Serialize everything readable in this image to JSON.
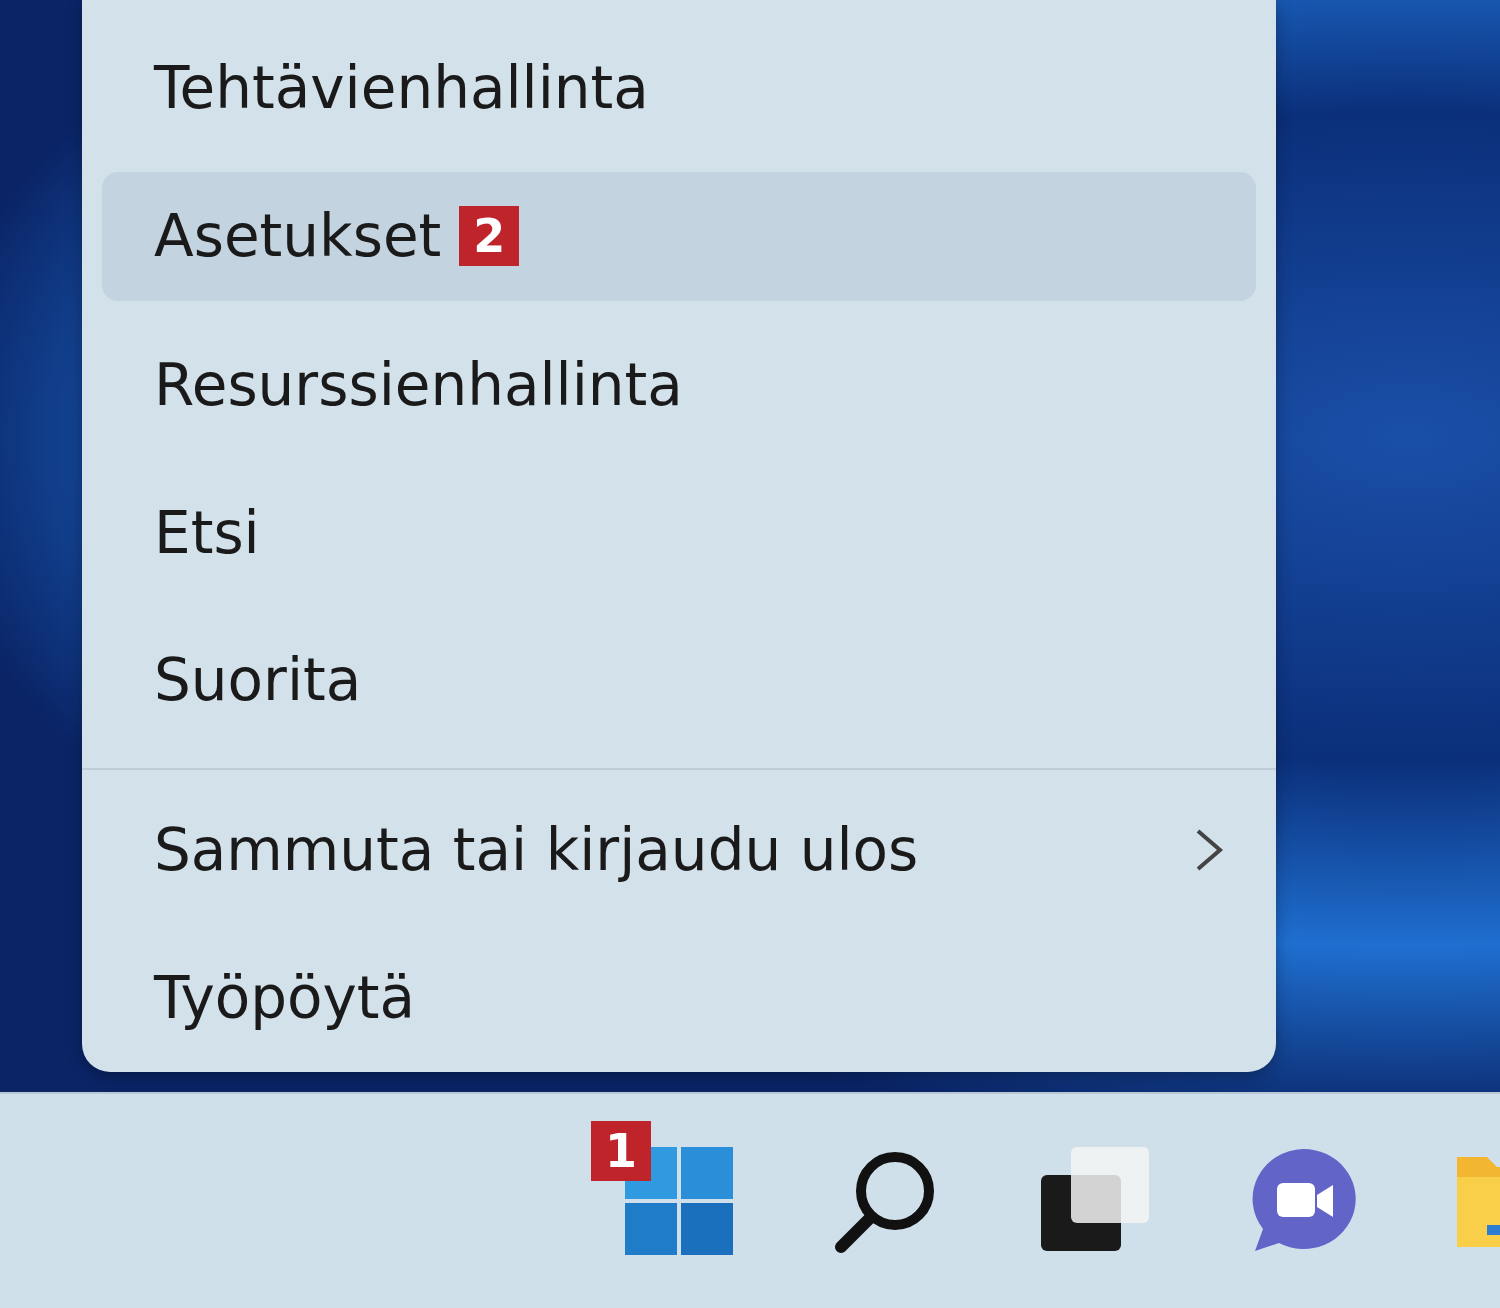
{
  "context_menu": {
    "items": [
      {
        "kind": "item",
        "label": "Tehtävienhallinta",
        "selected": false
      },
      {
        "kind": "item",
        "label": "Asetukset",
        "selected": true,
        "badge": "2"
      },
      {
        "kind": "item",
        "label": "Resurssienhallinta",
        "selected": false
      },
      {
        "kind": "item",
        "label": "Etsi",
        "selected": false
      },
      {
        "kind": "item",
        "label": "Suorita",
        "selected": false
      },
      {
        "kind": "separator"
      },
      {
        "kind": "submenu",
        "label": "Sammuta tai kirjaudu ulos",
        "selected": false
      },
      {
        "kind": "item",
        "label": "Työpöytä",
        "selected": false
      }
    ]
  },
  "taskbar": {
    "icons": [
      {
        "kind": "start",
        "badge": "1"
      },
      {
        "kind": "search"
      },
      {
        "kind": "task_view"
      },
      {
        "kind": "chat"
      },
      {
        "kind": "folder"
      }
    ]
  }
}
